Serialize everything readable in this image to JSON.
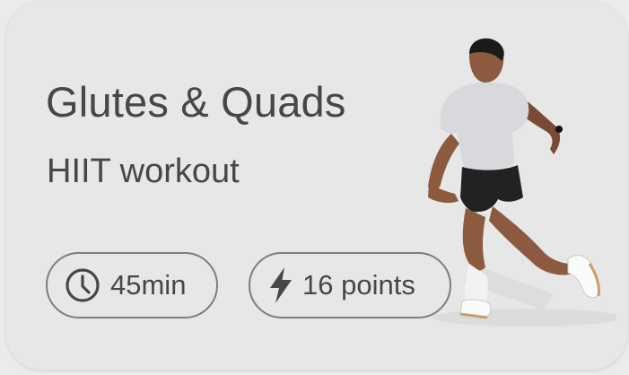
{
  "card": {
    "title": "Glutes & Quads",
    "subtitle": "HIIT workout",
    "duration": {
      "icon": "clock-icon",
      "label": "45min"
    },
    "points": {
      "icon": "lightning-bolt-icon",
      "label": "16 points"
    },
    "image": {
      "icon": "athlete-sprinting-photo"
    }
  },
  "colors": {
    "card_background": "#e7e7e7",
    "page_background": "#ebebeb",
    "text": "#474747",
    "pill_border": "#7d7d7d"
  }
}
